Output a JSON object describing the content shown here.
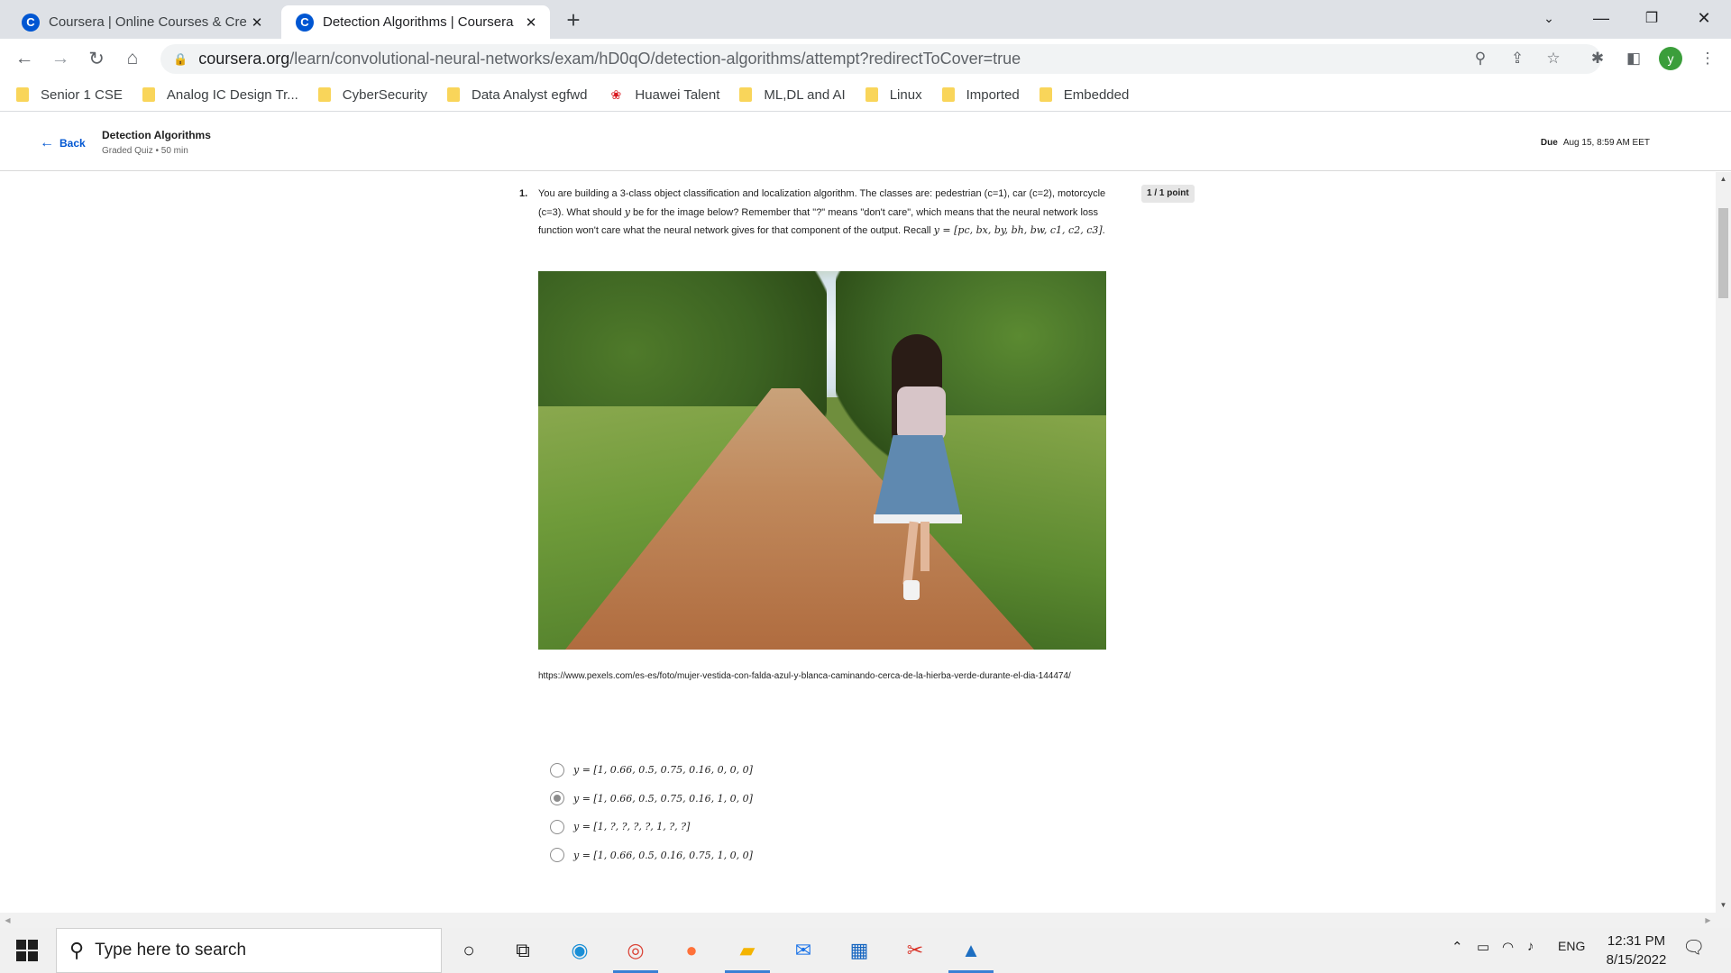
{
  "browser": {
    "tabs": [
      {
        "title": "Coursera | Online Courses & Cred",
        "favicon": "C",
        "active": false
      },
      {
        "title": "Detection Algorithms | Coursera",
        "favicon": "C",
        "active": true
      }
    ],
    "new_tab": "+",
    "url_host": "coursera.org",
    "url_path": "/learn/convolutional-neural-networks/exam/hD0qO/detection-algorithms/attempt?redirectToCover=true",
    "profile_initial": "y",
    "bookmarks": [
      {
        "label": "Senior 1 CSE",
        "icon": "folder-icon"
      },
      {
        "label": "Analog IC Design Tr...",
        "icon": "folder-icon"
      },
      {
        "label": "CyberSecurity",
        "icon": "folder-icon"
      },
      {
        "label": "Data Analyst egfwd",
        "icon": "folder-icon"
      },
      {
        "label": "Huawei Talent",
        "icon": "huawei-icon"
      },
      {
        "label": "ML,DL and AI",
        "icon": "folder-icon"
      },
      {
        "label": "Linux",
        "icon": "folder-icon"
      },
      {
        "label": "Imported",
        "icon": "folder-icon"
      },
      {
        "label": "Embedded",
        "icon": "folder-icon"
      }
    ]
  },
  "header": {
    "back_label": "Back",
    "quiz_title": "Detection Algorithms",
    "quiz_sub": "Graded Quiz • 50 min",
    "due_label": "Due",
    "due_date": "Aug 15, 8:59 AM EET"
  },
  "question": {
    "number": "1.",
    "text_a": "You are building a 3-class object classification and localization algorithm. The classes are: pedestrian (c=1), car (c=2), motorcycle (c=3). What should ",
    "var_y": "y",
    "text_b": " be for the image below? Remember that \"?\" means \"don't care\", which means that the neural network loss function won't care what the neural network gives for that component of the output. Recall ",
    "recall_formula": "y = [pc, bx, by, bh, bw, c1, c2, c3]",
    "text_c": ".",
    "points": "1 / 1 point",
    "image_credit": "https://www.pexels.com/es-es/foto/mujer-vestida-con-falda-azul-y-blanca-caminando-cerca-de-la-hierba-verde-durante-el-dia-144474/",
    "options": [
      {
        "label": "y = [1, 0.66, 0.5, 0.75, 0.16, 0, 0, 0]",
        "selected": false
      },
      {
        "label": "y = [1, 0.66, 0.5, 0.75, 0.16, 1, 0, 0]",
        "selected": true
      },
      {
        "label": "y = [1, ?, ?, ?, ?, 1, ?, ?]",
        "selected": false
      },
      {
        "label": "y = [1, 0.66, 0.5, 0.16, 0.75, 1, 0, 0]",
        "selected": false
      }
    ]
  },
  "taskbar": {
    "search_placeholder": "Type here to search",
    "language": "ENG",
    "time": "12:31 PM",
    "date": "8/15/2022"
  },
  "colors": {
    "coursera_blue": "#0056d2",
    "tab_strip": "#dee1e6",
    "profile_green": "#3b9e3b"
  }
}
